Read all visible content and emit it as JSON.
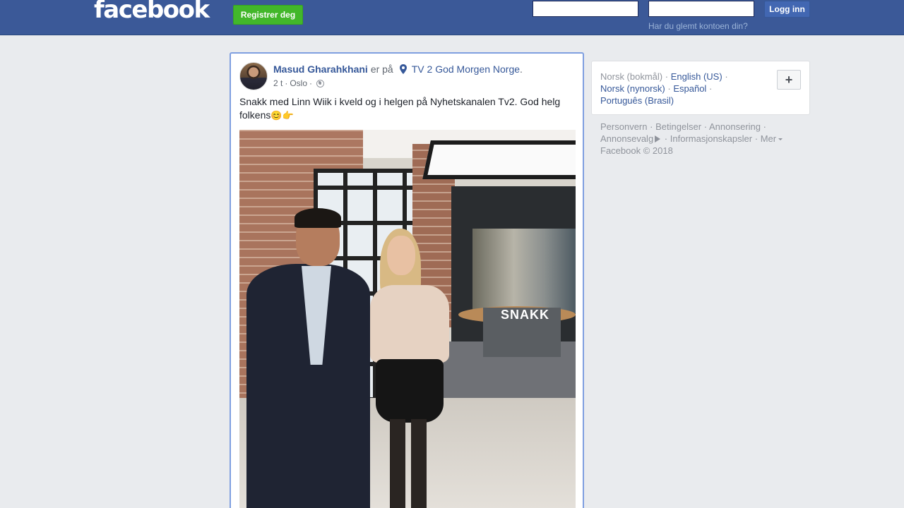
{
  "header": {
    "logo": "facebook",
    "register_label": "Registrer deg",
    "email_value": "",
    "password_value": "",
    "login_label": "Logg inn",
    "forgot_label": "Har du glemt kontoen din?"
  },
  "post": {
    "author": "Masud Gharahkhani",
    "at_text": "er på",
    "place": "TV 2 God Morgen Norge",
    "place_suffix": ".",
    "time": "2 t",
    "meta_sep1": "·",
    "location": "Oslo",
    "meta_sep2": "·",
    "privacy_icon": "globe-icon",
    "text": "Snakk med Linn Wiik i kveld og i helgen på Nyhetskanalen Tv2. God helg folkens",
    "emoji_1": "😊",
    "emoji_2": "👉",
    "photo_sign_text": "SNAKK"
  },
  "languages": {
    "current": "Norsk (bokmål)",
    "links": [
      "English (US)",
      "Norsk (nynorsk)",
      "Español",
      "Português (Brasil)"
    ],
    "separator": "·",
    "more_label": "+"
  },
  "footer": {
    "links": [
      "Personvern",
      "Betingelser",
      "Annonsering",
      "Annonsevalg",
      "Informasjonskapsler",
      "Mer"
    ],
    "copyright": "Facebook © 2018"
  },
  "colors": {
    "topbar": "#3b5998",
    "register_green": "#42b72a",
    "link_blue": "#365899",
    "background": "#e9ebee"
  }
}
